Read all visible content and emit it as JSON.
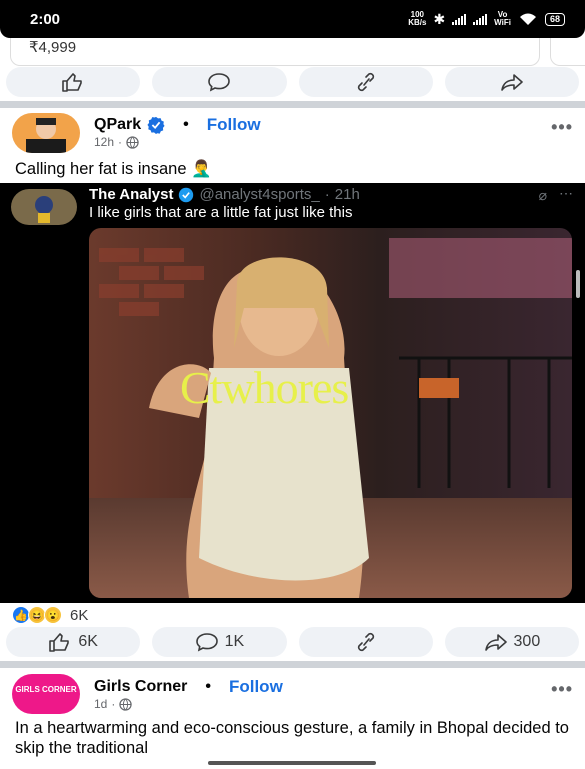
{
  "status_bar": {
    "time": "2:00",
    "net_speed_value": "100",
    "net_speed_unit": "KB/s",
    "volte": "Vo",
    "wifi_label": "WiFi",
    "battery": "68"
  },
  "ad": {
    "price": "₹4,999"
  },
  "top_actions": {
    "like_count": "",
    "comment_count": "",
    "share_count": ""
  },
  "post1": {
    "author": "QPark",
    "verified": true,
    "follow_label": "Follow",
    "time": "12h",
    "more_label": "•••",
    "text": "Calling her fat is insane 🤦‍♂️",
    "tweet": {
      "name": "The Analyst",
      "handle": "@analyst4sports_",
      "time": "21h",
      "text": "I like girls that are a little fat just like this",
      "watermark": "Ctwhores"
    },
    "reactions": {
      "icons": [
        "like",
        "haha",
        "wow"
      ],
      "count": "6K"
    },
    "actions": {
      "like": "6K",
      "comment": "1K",
      "share": "300"
    }
  },
  "post2": {
    "author": "Girls Corner",
    "avatar_text": "GIRLS CORNER",
    "follow_label": "Follow",
    "time": "1d",
    "more_label": "•••",
    "text": "In a heartwarming and eco-conscious gesture, a family in Bhopal decided to skip the traditional"
  },
  "colors": {
    "accent_blue": "#1a6fe0",
    "action_bg": "#eff2f6",
    "divider": "#cfd3d8",
    "girls_corner_pink": "#ee1889"
  }
}
